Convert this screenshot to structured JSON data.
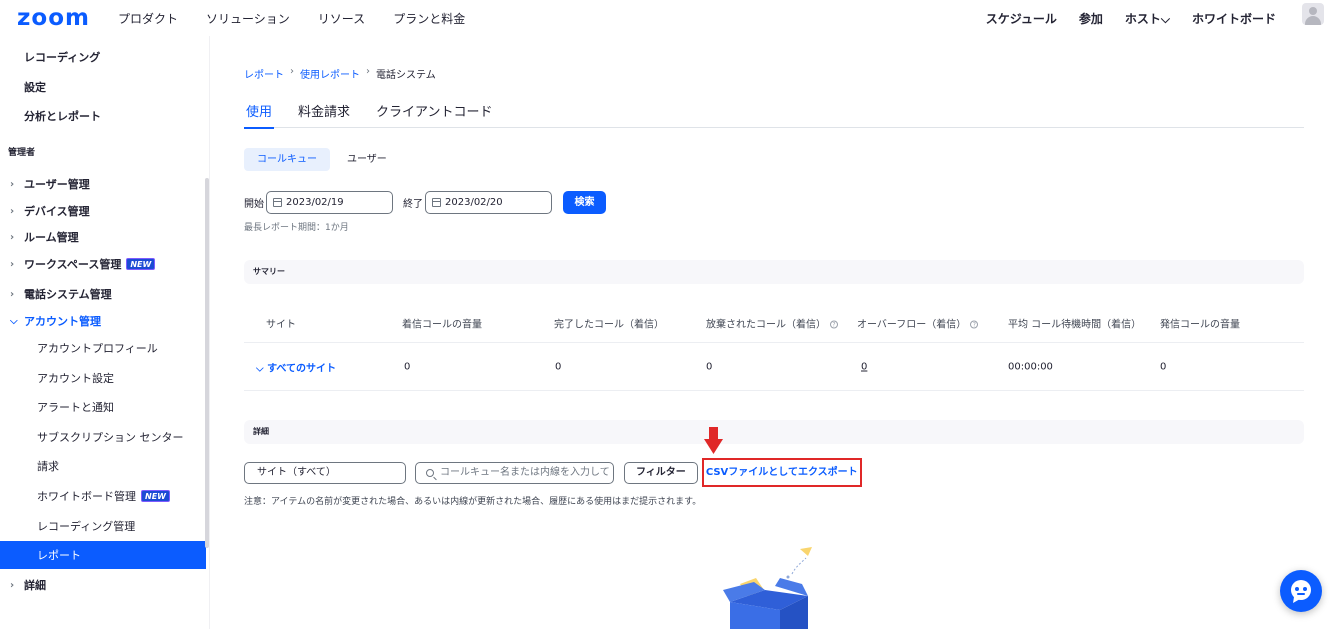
{
  "topnav": {
    "logo": "zoom",
    "left_items": [
      "プロダクト",
      "ソリューション",
      "リソース",
      "プランと料金"
    ],
    "right_items": [
      "スケジュール",
      "参加",
      "ホスト⌵",
      "ホワイトボード"
    ]
  },
  "sidebar": {
    "top_items": [
      "レコーディング",
      "設定",
      "分析とレポート"
    ],
    "admin_header": "管理者",
    "groups": [
      {
        "label": "ユーザー管理",
        "new": false
      },
      {
        "label": "デバイス管理",
        "new": false
      },
      {
        "label": "ルーム管理",
        "new": false
      },
      {
        "label": "ワークスペース管理",
        "new": true
      },
      {
        "label": "電話システム管理",
        "new": false
      }
    ],
    "open_group": "アカウント管理",
    "sub_items": [
      {
        "label": "アカウントプロフィール",
        "new": false
      },
      {
        "label": "アカウント設定",
        "new": false
      },
      {
        "label": "アラートと通知",
        "new": false
      },
      {
        "label": "サブスクリプション センター",
        "new": false
      },
      {
        "label": "請求",
        "new": false
      },
      {
        "label": "ホワイトボード管理",
        "new": true
      },
      {
        "label": "レコーディング管理",
        "new": false
      },
      {
        "label": "レポート",
        "new": false
      }
    ],
    "bottom_group": "詳細",
    "new_badge": "NEW"
  },
  "breadcrumb": {
    "items": [
      "レポート",
      "使用レポート",
      "電話システム"
    ],
    "sep": "›"
  },
  "tabs": [
    "使用",
    "料金請求",
    "クライアントコード"
  ],
  "segments": [
    "コールキュー",
    "ユーザー"
  ],
  "dates": {
    "start_label": "開始",
    "start_value": "2023/02/19",
    "end_label": "終了",
    "end_value": "2023/02/20",
    "search_label": "検索",
    "hint": "最長レポート期間：1か月"
  },
  "summary": {
    "title": "サマリー",
    "columns": [
      "サイト",
      "着信コールの音量",
      "完了したコール（着信）",
      "放棄されたコール（着信）",
      "オーバーフロー（着信）",
      "平均 コール待機時間（着信）",
      "発信コールの音量"
    ],
    "row": [
      "すべてのサイト",
      "0",
      "0",
      "0",
      "0",
      "00:00:00",
      "0"
    ],
    "row_chevron": "⌵"
  },
  "details": {
    "title": "詳細",
    "site_select": "サイト（すべて）",
    "queue_placeholder": "コールキュー名または内線を入力して",
    "filter_label": "フィルター",
    "export_label": "CSVファイルとしてエクスポート",
    "note": "注意：アイテムの名前が変更された場合、あるいは内線が更新された場合、履歴にある使用はまだ提示されます。"
  },
  "colors": {
    "accent": "#0b5cff",
    "highlight": "#e02828"
  }
}
